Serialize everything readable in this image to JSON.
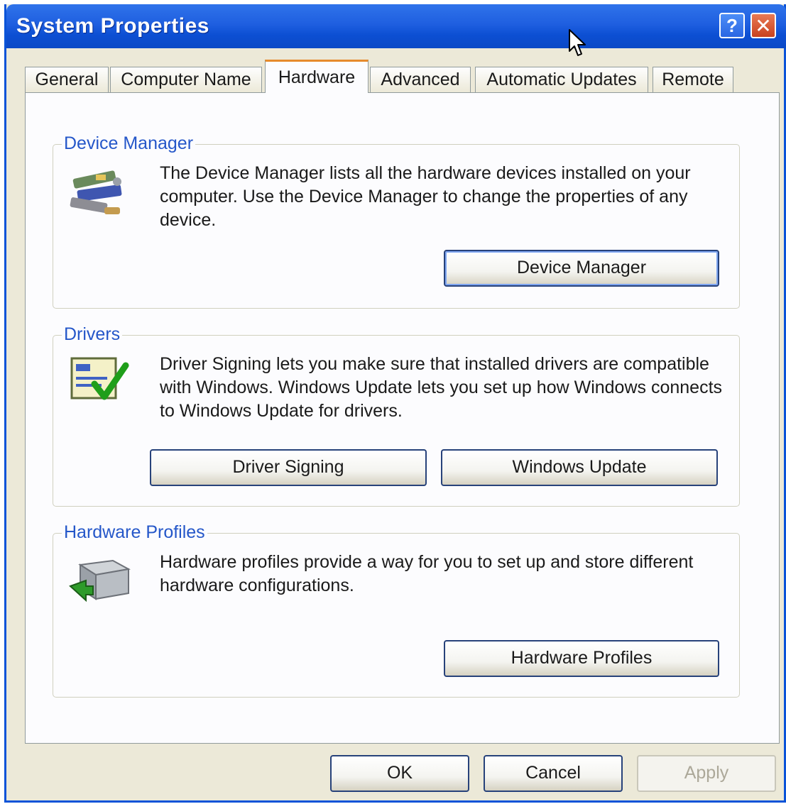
{
  "window": {
    "title": "System Properties"
  },
  "titlebar": {
    "help_label": "?",
    "close_label": "✕"
  },
  "tabs": [
    {
      "label": "General"
    },
    {
      "label": "Computer Name"
    },
    {
      "label": "Hardware"
    },
    {
      "label": "Advanced"
    },
    {
      "label": "Automatic Updates"
    },
    {
      "label": "Remote"
    }
  ],
  "active_tab": "Hardware",
  "groups": {
    "device_manager": {
      "label": "Device Manager",
      "description": "The Device Manager lists all the hardware devices installed on your computer. Use the Device Manager to change the properties of any device.",
      "button": "Device Manager",
      "icon": "device-manager-icon"
    },
    "drivers": {
      "label": "Drivers",
      "description": "Driver Signing lets you make sure that installed drivers are compatible with Windows. Windows Update lets you set up how Windows connects to Windows Update for drivers.",
      "button_signing": "Driver Signing",
      "button_update": "Windows Update",
      "icon": "driver-signing-icon"
    },
    "hardware_profiles": {
      "label": "Hardware Profiles",
      "description": "Hardware profiles provide a way for you to set up and store different hardware configurations.",
      "button": "Hardware Profiles",
      "icon": "hardware-profiles-icon"
    }
  },
  "footer": {
    "ok": "OK",
    "cancel": "Cancel",
    "apply": "Apply"
  },
  "colors": {
    "titlebar": "#0c4fd3",
    "group_label": "#2557c9",
    "active_tab_accent": "#e68b2c",
    "dialog_bg": "#ece9d8"
  }
}
